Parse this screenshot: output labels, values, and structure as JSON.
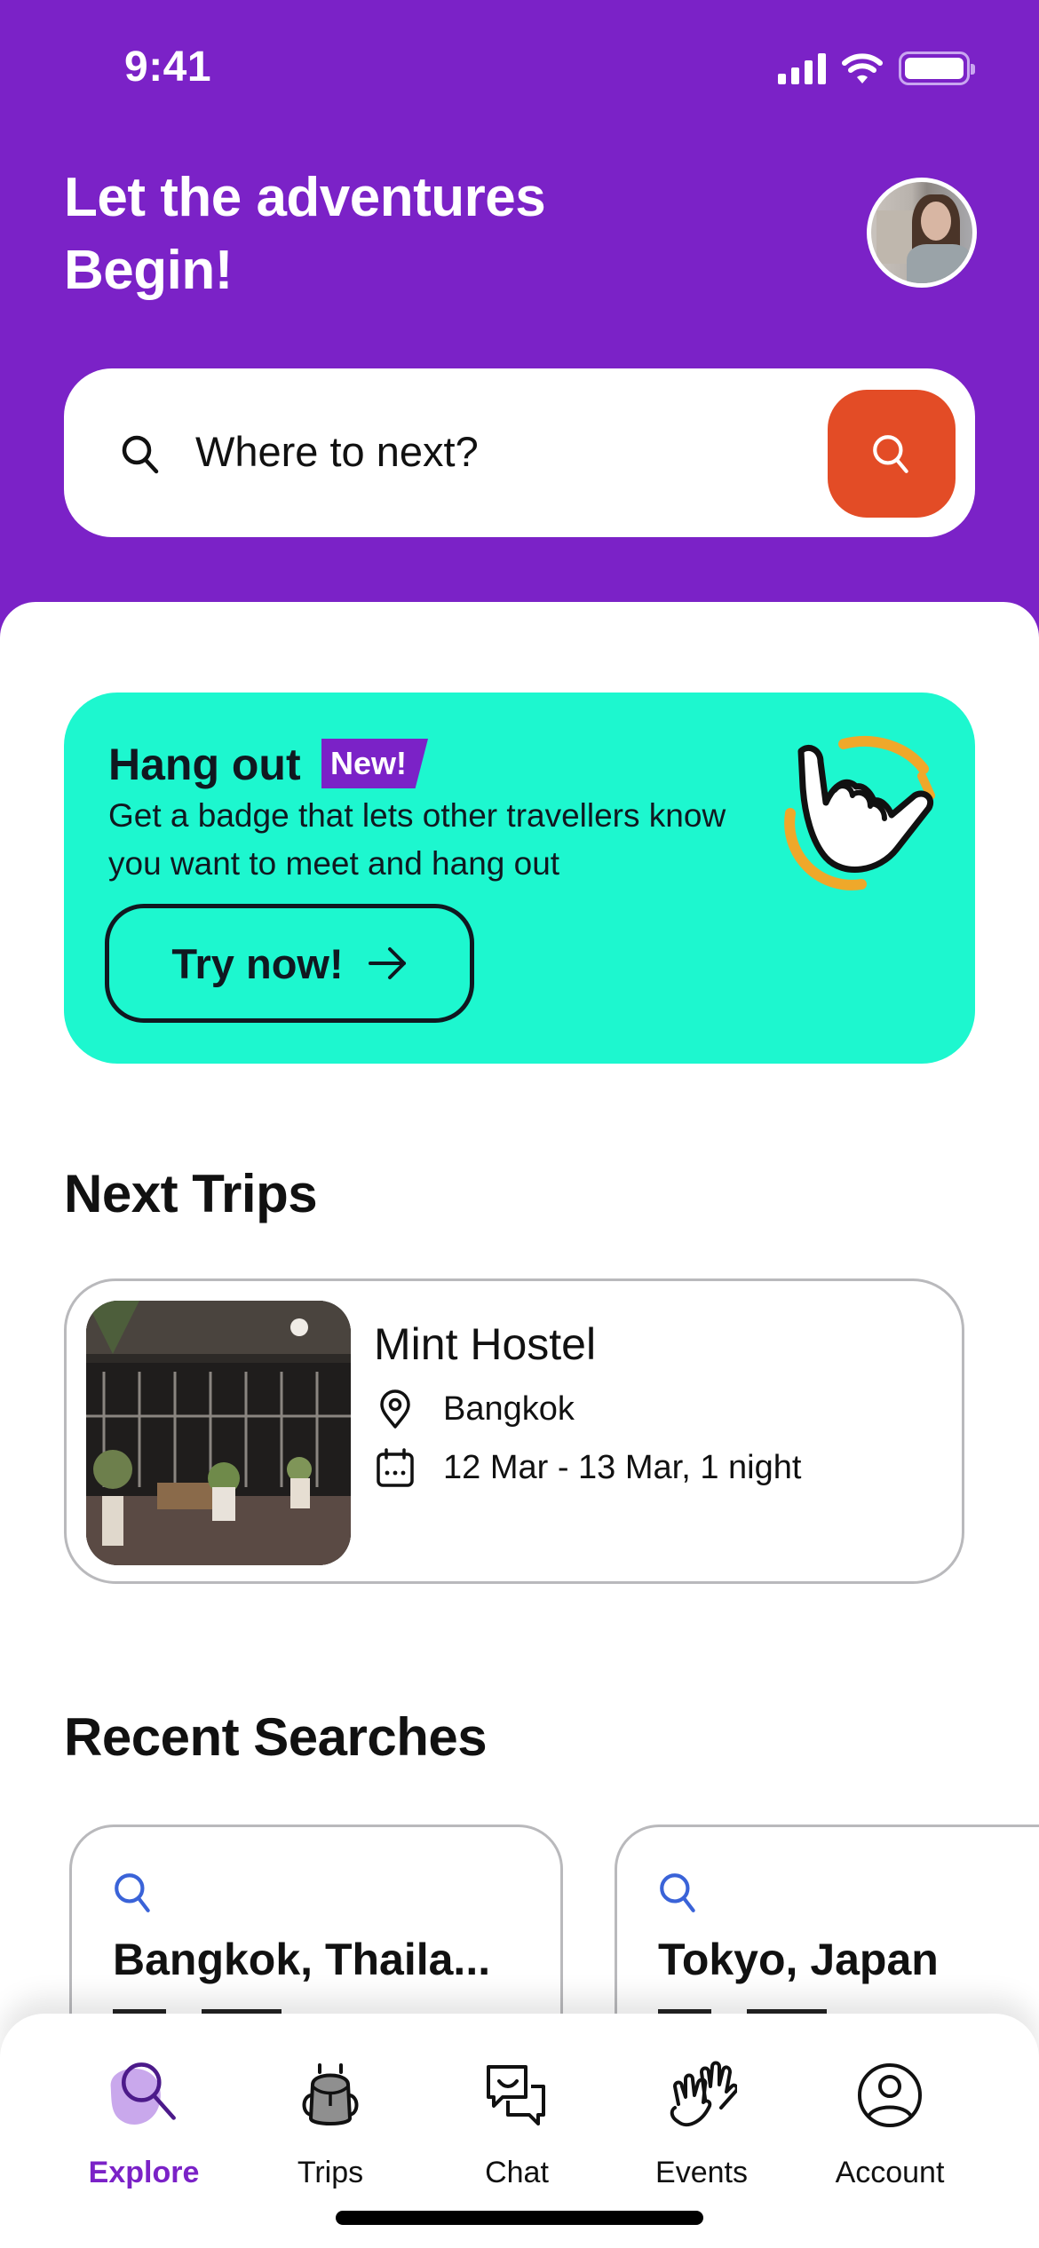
{
  "status_bar": {
    "time": "9:41",
    "icons": [
      "cellular-signal-icon",
      "wifi-icon",
      "battery-icon"
    ]
  },
  "header": {
    "title": "Let the adventures Begin!",
    "avatar_alt": "User profile photo"
  },
  "search": {
    "placeholder": "Where to next?",
    "leading_icon": "search-icon",
    "button_icon": "search-icon"
  },
  "promo": {
    "title": "Hang out",
    "badge": "New!",
    "description": "Get a badge that lets other travellers know you want to meet and hang out",
    "cta_label": "Try now!",
    "cta_icon": "arrow-right-icon",
    "illustration": "shaka-hand-icon"
  },
  "next_trips": {
    "heading": "Next Trips",
    "items": [
      {
        "name": "Mint Hostel",
        "location": "Bangkok",
        "dates": "12 Mar - 13 Mar, 1 night"
      }
    ]
  },
  "recent_searches": {
    "heading": "Recent Searches",
    "items": [
      {
        "title": "Bangkok, Thaila..."
      },
      {
        "title": "Tokyo, Japan"
      }
    ]
  },
  "bottom_nav": {
    "items": [
      {
        "label": "Explore",
        "icon": "search-icon",
        "active": true
      },
      {
        "label": "Trips",
        "icon": "backpack-icon",
        "active": false
      },
      {
        "label": "Chat",
        "icon": "chat-bubbles-icon",
        "active": false
      },
      {
        "label": "Events",
        "icon": "high-five-hands-icon",
        "active": false
      },
      {
        "label": "Account",
        "icon": "user-circle-icon",
        "active": false
      }
    ]
  },
  "colors": {
    "brand_purple": "#7B22C7",
    "search_button_orange": "#E34C26",
    "promo_mint": "#1DF7CF",
    "recent_search_icon_blue": "#3A63D8",
    "illustration_accent": "#EFA82A"
  }
}
